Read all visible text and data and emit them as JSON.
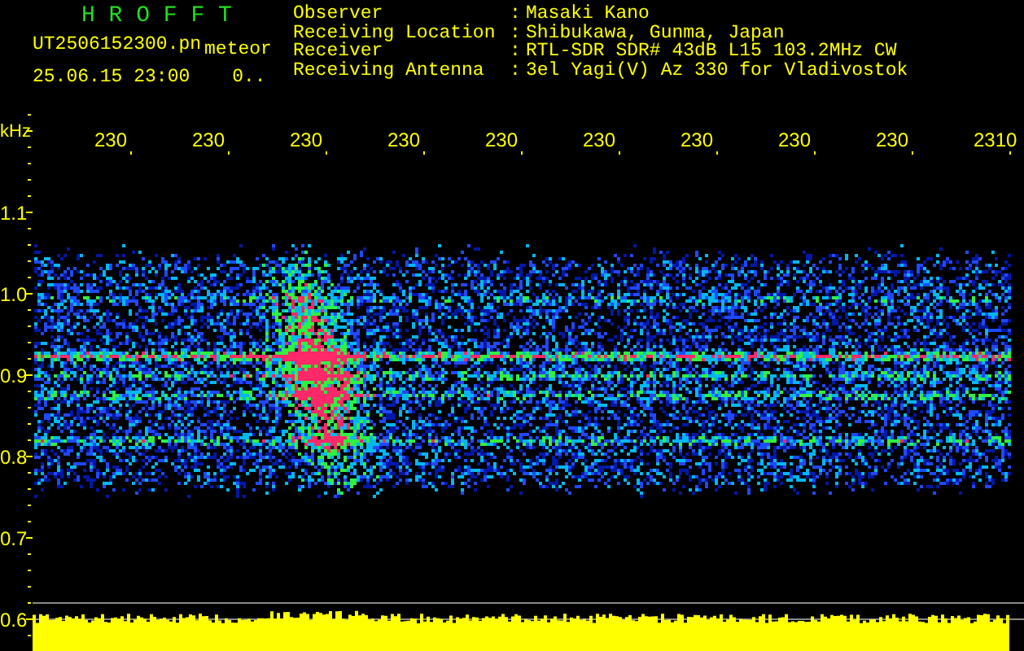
{
  "header": {
    "title": "H R O F F T",
    "file_name": "UT2506152300.pn",
    "mode": "meteor",
    "timestamp": "25.06.15 23:00",
    "count": "0.."
  },
  "info": [
    {
      "label": "Observer",
      "separator": ":",
      "value": "Masaki Kano"
    },
    {
      "label": "Receiving Location",
      "separator": ":",
      "value": "Shibukawa, Gunma, Japan"
    },
    {
      "label": "Receiver",
      "separator": ":",
      "value": "RTL-SDR SDR# 43dB L15 103.2MHz CW"
    },
    {
      "label": "Receiving Antenna",
      "separator": ":",
      "value": "3el Yagi(V) Az 330 for Vladivostok"
    }
  ],
  "axis": {
    "unit": "kHz",
    "x_ticks": [
      "230",
      "230",
      "230",
      "230",
      "230",
      "230",
      "230",
      "230",
      "230",
      "2310"
    ],
    "y_ticks": [
      "1.1",
      "1.0",
      "0.9",
      "0.8",
      "0.7",
      "0.6"
    ]
  }
}
